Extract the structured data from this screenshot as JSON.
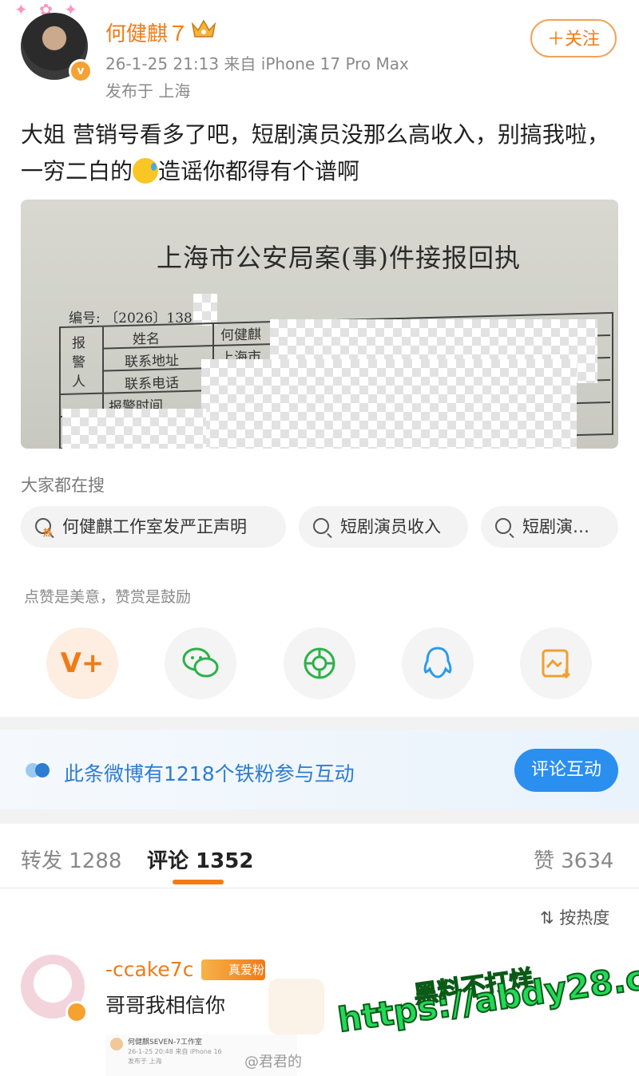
{
  "post": {
    "author": "何健麒７",
    "meta": "26-1-25 21:13  来自 iPhone 17 Pro Max",
    "location": "发布于 上海",
    "follow_label": "＋关注",
    "text_part1": "大姐 营销号看多了吧，短剧演员没那么高收入，别搞我啦，一穷二白的",
    "text_part2": "造谣你都得有个谱啊"
  },
  "photo": {
    "title": "上海市公安局案(事)件接报回执",
    "number": "编号: 〔2026〕1386",
    "side_label": "报警人",
    "row_name": "姓名",
    "row_name_value": "何健麒",
    "row_address": "联系地址",
    "row_address_value": "上海市",
    "row_phone": "联系电话",
    "row_time": "报警时间"
  },
  "search": {
    "title": "大家都在搜",
    "hot_tag": "热",
    "chips": [
      "何健麒工作室发严正声明",
      "短剧演员收入",
      "短剧演…"
    ]
  },
  "reward": {
    "text": "点赞是美意，赞赏是鼓励"
  },
  "share_icons": [
    "vip-reward-icon",
    "wechat-icon",
    "moments-icon",
    "qq-icon",
    "save-image-icon"
  ],
  "banner": {
    "text": "此条微博有1218个铁粉参与互动",
    "button": "评论互动"
  },
  "tabs": {
    "repost": "转发 1288",
    "comments": "评论 1352",
    "likes": "赞 3634"
  },
  "sort_label": "按热度",
  "comment": {
    "user": "-ccake7c",
    "fan_badge": "真爱粉",
    "text": "哥哥我相信你",
    "thumb_name": "何健麒SEVEN-7工作室",
    "thumb_meta": "26-1-25 20:48  来自 iPhone 16",
    "thumb_loc": "发布于 上海"
  },
  "watermark": {
    "line1": "黑料不打烊",
    "line2": "https://abdy28.com",
    "source": "@君君的"
  },
  "colors": {
    "accent_orange": "#f07b17",
    "link_blue": "#2d7dd2",
    "button_blue": "#2b8ff0"
  }
}
